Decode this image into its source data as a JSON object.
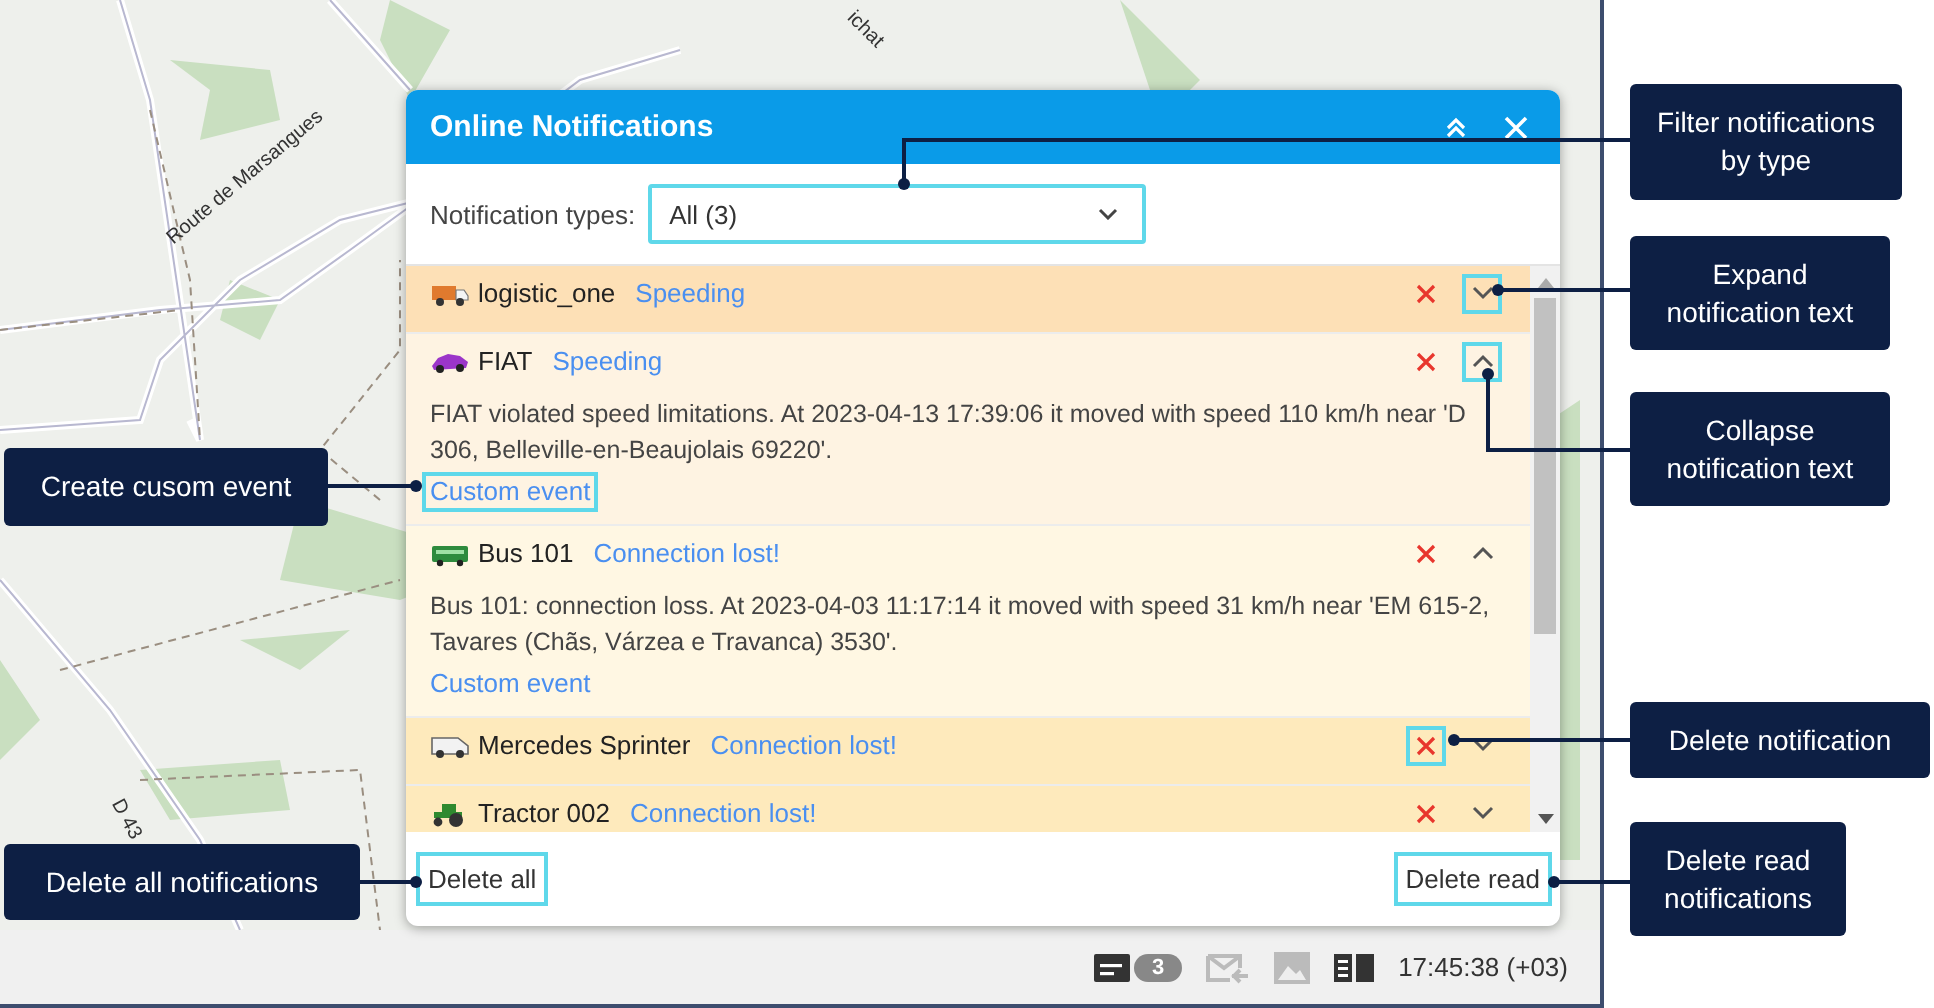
{
  "map": {
    "labels": [
      "ichat",
      "Route de Marsangues",
      "D 43"
    ]
  },
  "dialog": {
    "title": "Online Notifications",
    "filter": {
      "label": "Notification types:",
      "value": "All (3)",
      "highlighted": true
    },
    "notifications": [
      {
        "unit": "logistic_one",
        "type": "Speeding",
        "expanded": false,
        "color": "#fde0b6",
        "toggle_highlighted": true,
        "delete_highlighted": false
      },
      {
        "unit": "FIAT",
        "type": "Speeding",
        "expanded": true,
        "color": "#fef3e2",
        "toggle_highlighted": true,
        "delete_highlighted": false,
        "text": "FIAT violated speed limitations. At 2023-04-13 17:39:06 it moved with speed 110 km/h near 'D 306, Belleville-en-Beaujolais 69220'.",
        "event_link": "Custom event",
        "event_highlighted": true
      },
      {
        "unit": "Bus 101",
        "type": "Connection lost!",
        "expanded": true,
        "color": "#fff7e3",
        "toggle_highlighted": false,
        "delete_highlighted": false,
        "text": "Bus 101: connection loss. At 2023-04-03 11:17:14 it moved with speed 31 km/h near 'EM 615-2, Tavares (Chãs, Várzea e Travanca) 3530'.",
        "event_link": "Custom event",
        "event_highlighted": false
      },
      {
        "unit": "Mercedes Sprinter",
        "type": "Connection lost!",
        "expanded": false,
        "color": "#feeabc",
        "toggle_highlighted": false,
        "delete_highlighted": true
      },
      {
        "unit": "Tractor 002",
        "type": "Connection lost!",
        "expanded": false,
        "color": "#feeabc",
        "toggle_highlighted": false,
        "delete_highlighted": false
      }
    ],
    "delete_all": {
      "label": "Delete all",
      "highlighted": true
    },
    "delete_read": {
      "label": "Delete read",
      "highlighted": true
    }
  },
  "status_bar": {
    "badge": "3",
    "time": "17:45:38 (+03)"
  },
  "callouts": [
    {
      "text": "Filter notifications by type"
    },
    {
      "text": "Expand notification text"
    },
    {
      "text": "Collapse notification text"
    },
    {
      "text": "Create cusom event"
    },
    {
      "text": "Delete notification"
    },
    {
      "text": "Delete all notifications"
    },
    {
      "text": "Delete read notifications"
    }
  ]
}
